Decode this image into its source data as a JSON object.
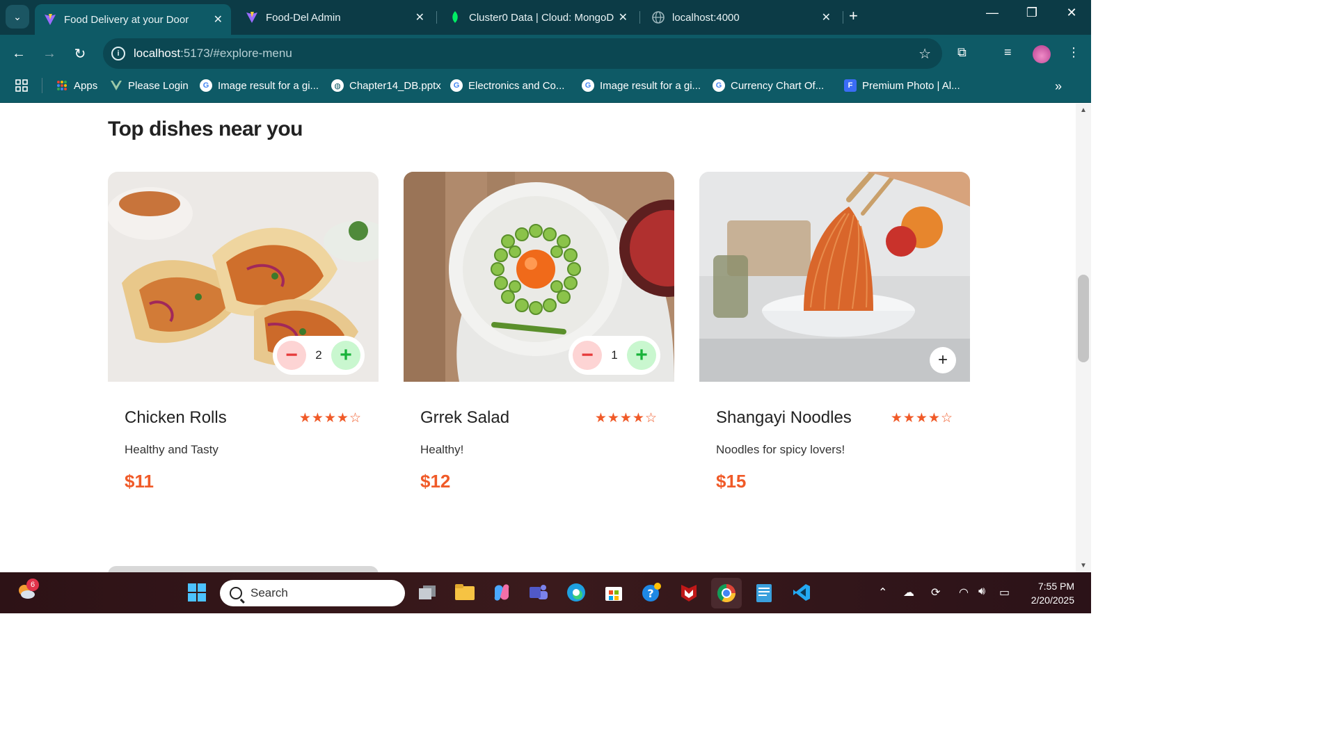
{
  "browser": {
    "tabs": [
      {
        "label": "Food Delivery at your Door",
        "active": true
      },
      {
        "label": "Food-Del Admin",
        "active": false
      },
      {
        "label": "Cluster0 Data | Cloud: MongoD",
        "active": false
      },
      {
        "label": "localhost:4000",
        "active": false
      }
    ],
    "url_host": "localhost",
    "url_rest": ":5173/#explore-menu",
    "bookmarks": [
      {
        "label": "Apps"
      },
      {
        "label": "Please Login"
      },
      {
        "label": "Image result for a gi..."
      },
      {
        "label": "Chapter14_DB.pptx"
      },
      {
        "label": "Electronics and Co..."
      },
      {
        "label": "Image result for a gi..."
      },
      {
        "label": "Currency Chart Of..."
      },
      {
        "label": "Premium Photo | Al..."
      }
    ]
  },
  "page": {
    "heading": "Top dishes near you",
    "dishes": [
      {
        "name": "Chicken Rolls",
        "description": "Healthy and Tasty",
        "price": "$11",
        "rating": 4,
        "quantity": "2"
      },
      {
        "name": "Grrek Salad",
        "description": "Healthy!",
        "price": "$12",
        "rating": 4,
        "quantity": "1"
      },
      {
        "name": "Shangayi Noodles",
        "description": "Noodles for spicy lovers!",
        "price": "$15",
        "rating": 4,
        "quantity": null
      }
    ],
    "accent_color": "#f05a28"
  },
  "taskbar": {
    "search_placeholder": "Search",
    "notification_count": "6",
    "time": "7:55 PM",
    "date": "2/20/2025"
  }
}
